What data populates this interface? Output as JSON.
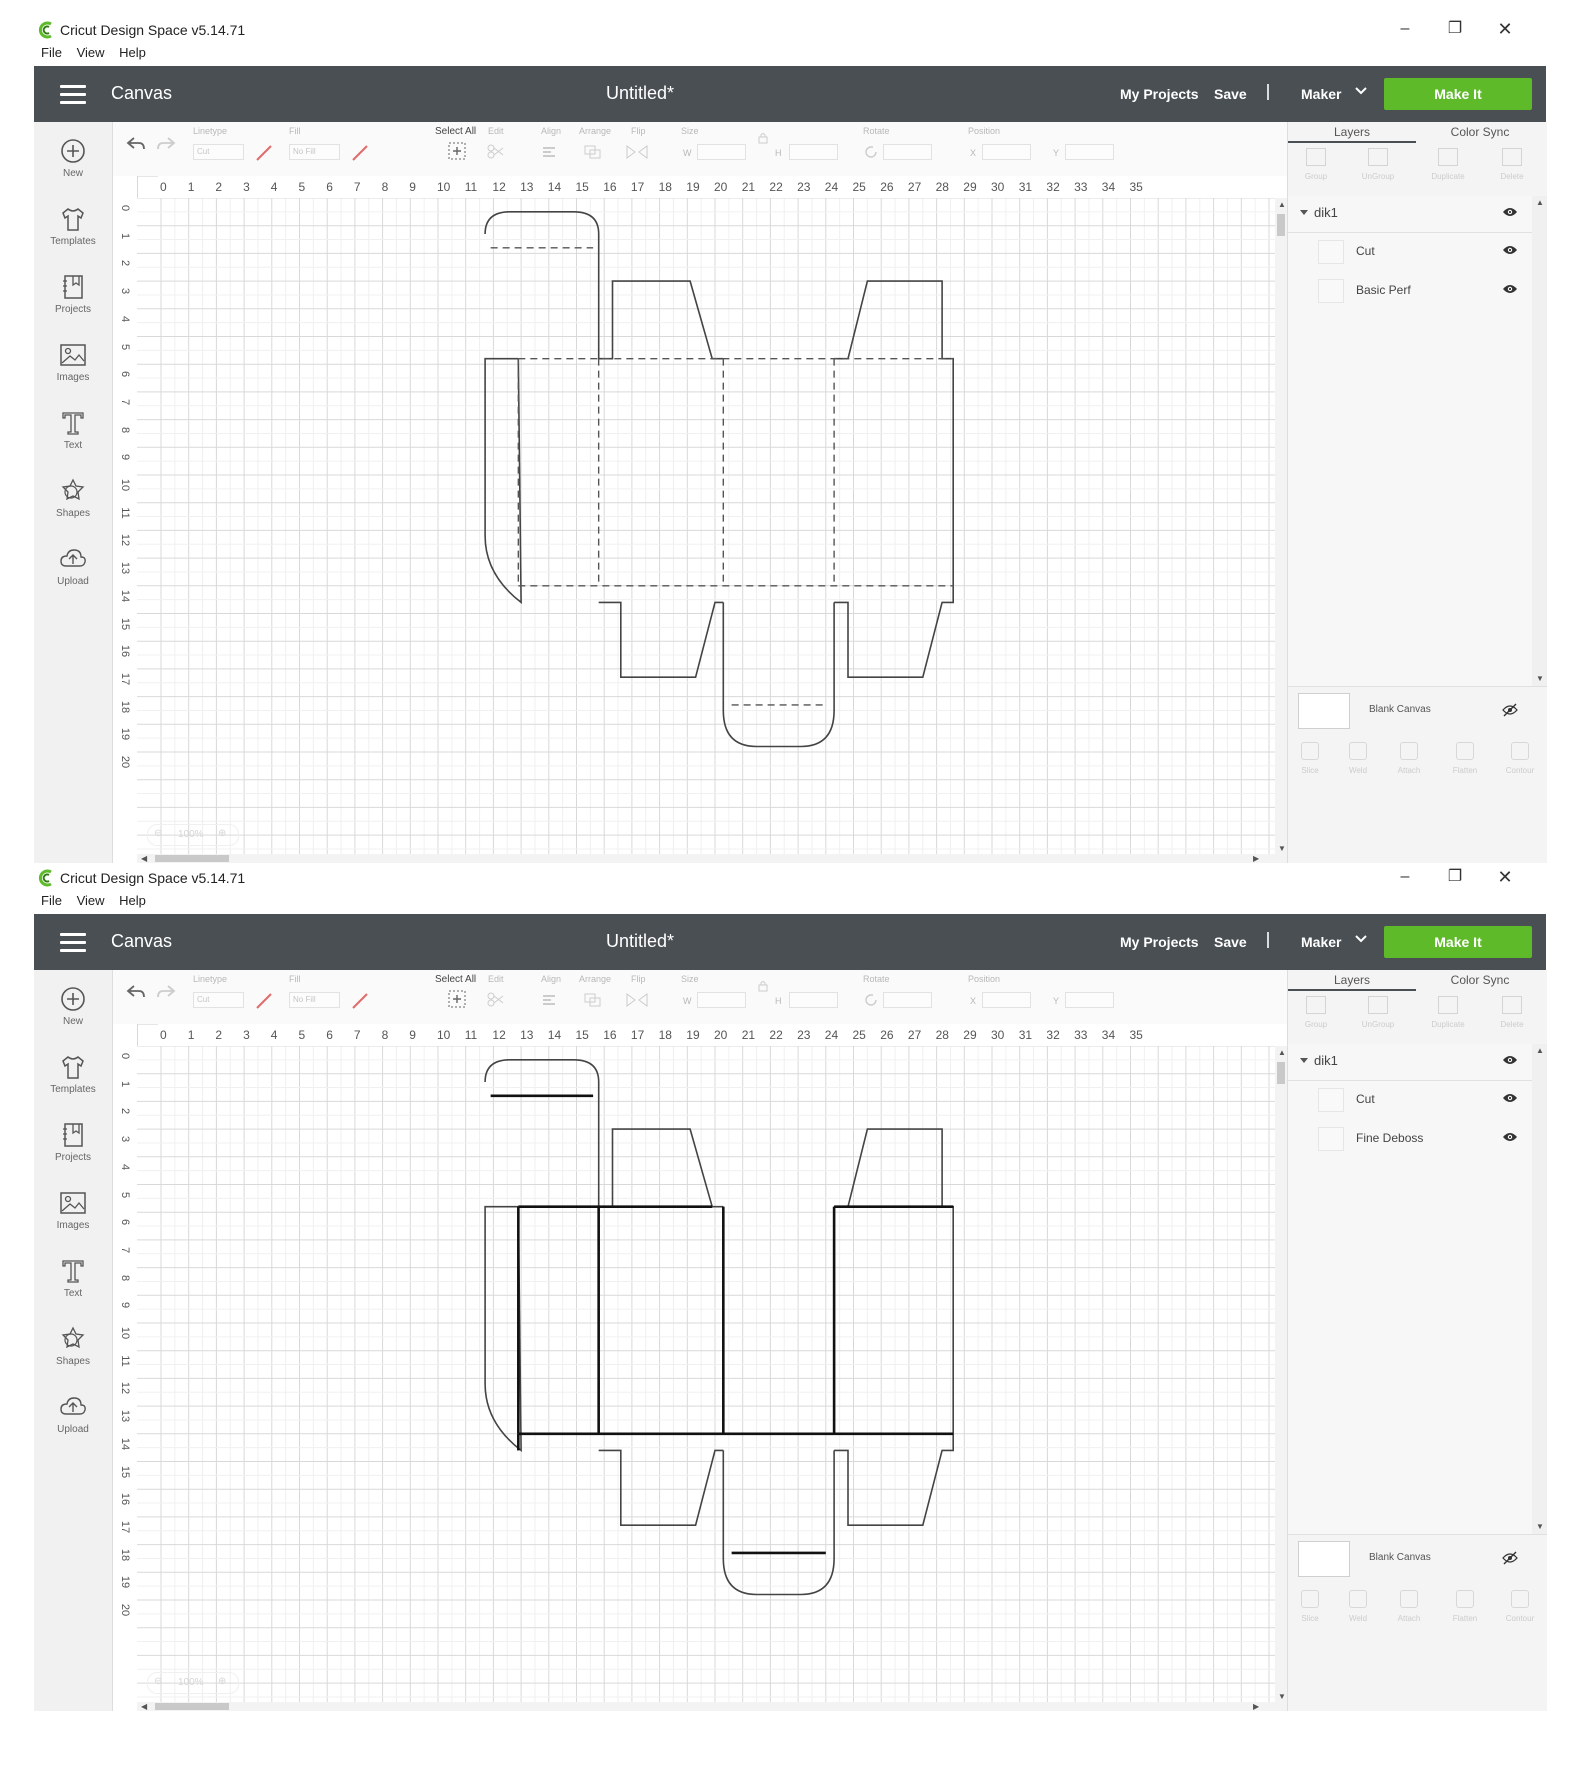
{
  "windows": [
    {
      "app_title": "Cricut Design Space  v5.14.71",
      "menu": [
        "File",
        "View",
        "Help"
      ],
      "header": {
        "canvas_label": "Canvas",
        "doc_title": "Untitled*",
        "my_projects": "My Projects",
        "save": "Save",
        "separator": "|",
        "machine": "Maker",
        "make_it": "Make It",
        "make_it_color": "#5fba2a",
        "header_color": "#4a4f54"
      },
      "left_nav": [
        {
          "label": "New",
          "icon": "plus-circle-icon"
        },
        {
          "label": "Templates",
          "icon": "tshirt-icon"
        },
        {
          "label": "Projects",
          "icon": "projects-icon"
        },
        {
          "label": "Images",
          "icon": "image-icon"
        },
        {
          "label": "Text",
          "icon": "text-icon"
        },
        {
          "label": "Shapes",
          "icon": "shapes-icon"
        },
        {
          "label": "Upload",
          "icon": "upload-cloud-icon"
        }
      ],
      "toolbar": {
        "linetype": "Linetype",
        "linetype_value": "Cut",
        "fill": "Fill",
        "fill_value": "No Fill",
        "select_all": "Select All",
        "edit": "Edit",
        "align": "Align",
        "arrange": "Arrange",
        "flip": "Flip",
        "size": "Size",
        "size_w": "W",
        "size_h": "H",
        "rotate": "Rotate",
        "position": "Position",
        "pos_x": "X",
        "pos_y": "Y"
      },
      "ruler_h": [
        "0",
        "1",
        "2",
        "3",
        "4",
        "5",
        "6",
        "7",
        "8",
        "9",
        "10",
        "11",
        "12",
        "13",
        "14",
        "15",
        "16",
        "17",
        "18",
        "19",
        "20",
        "21",
        "22",
        "23",
        "24",
        "25",
        "26",
        "27",
        "28",
        "29",
        "30",
        "31",
        "32",
        "33",
        "34",
        "35"
      ],
      "ruler_v": [
        "0",
        "1",
        "2",
        "3",
        "4",
        "5",
        "6",
        "7",
        "8",
        "9",
        "10",
        "11",
        "12",
        "13",
        "14",
        "15",
        "16",
        "17",
        "18",
        "19",
        "20"
      ],
      "zoom": "100%",
      "panel": {
        "tabs": [
          "Layers",
          "Color Sync"
        ],
        "tools": [
          "Group",
          "UnGroup",
          "Duplicate",
          "Delete"
        ],
        "group_name": "dik1",
        "layers": [
          {
            "name": "Cut"
          },
          {
            "name": "Basic Perf"
          }
        ],
        "blank_canvas": "Blank Canvas",
        "bottom_tools": [
          "Slice",
          "Weld",
          "Attach",
          "Flatten",
          "Contour"
        ]
      },
      "score_style": "dashed"
    },
    {
      "app_title": "Cricut Design Space  v5.14.71",
      "menu": [
        "File",
        "View",
        "Help"
      ],
      "header": {
        "canvas_label": "Canvas",
        "doc_title": "Untitled*",
        "my_projects": "My Projects",
        "save": "Save",
        "separator": "|",
        "machine": "Maker",
        "make_it": "Make It",
        "make_it_color": "#5fba2a",
        "header_color": "#4a4f54"
      },
      "left_nav": [
        {
          "label": "New",
          "icon": "plus-circle-icon"
        },
        {
          "label": "Templates",
          "icon": "tshirt-icon"
        },
        {
          "label": "Projects",
          "icon": "projects-icon"
        },
        {
          "label": "Images",
          "icon": "image-icon"
        },
        {
          "label": "Text",
          "icon": "text-icon"
        },
        {
          "label": "Shapes",
          "icon": "shapes-icon"
        },
        {
          "label": "Upload",
          "icon": "upload-cloud-icon"
        }
      ],
      "toolbar": {
        "linetype": "Linetype",
        "linetype_value": "Cut",
        "fill": "Fill",
        "fill_value": "No Fill",
        "select_all": "Select All",
        "edit": "Edit",
        "align": "Align",
        "arrange": "Arrange",
        "flip": "Flip",
        "size": "Size",
        "size_w": "W",
        "size_h": "H",
        "rotate": "Rotate",
        "position": "Position",
        "pos_x": "X",
        "pos_y": "Y"
      },
      "ruler_h": [
        "0",
        "1",
        "2",
        "3",
        "4",
        "5",
        "6",
        "7",
        "8",
        "9",
        "10",
        "11",
        "12",
        "13",
        "14",
        "15",
        "16",
        "17",
        "18",
        "19",
        "20",
        "21",
        "22",
        "23",
        "24",
        "25",
        "26",
        "27",
        "28",
        "29",
        "30",
        "31",
        "32",
        "33",
        "34",
        "35"
      ],
      "ruler_v": [
        "0",
        "1",
        "2",
        "3",
        "4",
        "5",
        "6",
        "7",
        "8",
        "9",
        "10",
        "11",
        "12",
        "13",
        "14",
        "15",
        "16",
        "17",
        "18",
        "19",
        "20"
      ],
      "zoom": "100%",
      "panel": {
        "tabs": [
          "Layers",
          "Color Sync"
        ],
        "tools": [
          "Group",
          "UnGroup",
          "Duplicate",
          "Delete"
        ],
        "group_name": "dik1",
        "layers": [
          {
            "name": "Cut"
          },
          {
            "name": "Fine Deboss"
          }
        ],
        "blank_canvas": "Blank Canvas",
        "bottom_tools": [
          "Slice",
          "Weld",
          "Attach",
          "Flatten",
          "Contour"
        ]
      },
      "score_style": "bold"
    }
  ]
}
